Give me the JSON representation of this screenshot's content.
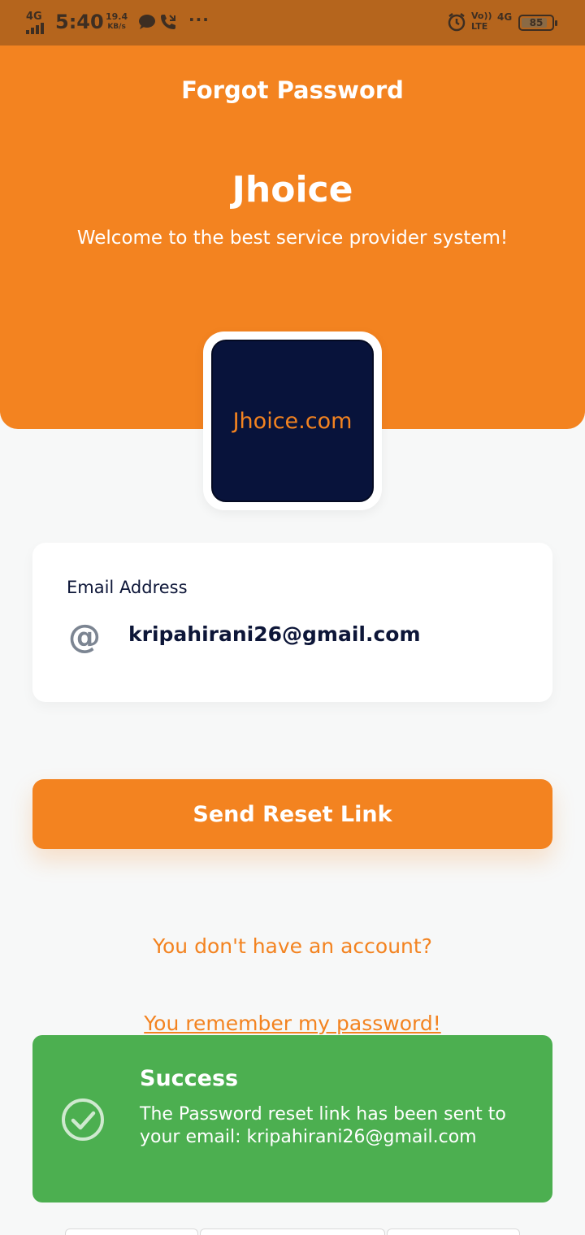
{
  "status_bar": {
    "network": "4G",
    "time": "5:40",
    "speed_value": "19.4",
    "speed_unit": "KB/s",
    "more": "···",
    "volte_top": "Vo))",
    "volte_bottom": "LTE",
    "network_right": "4G",
    "battery": "85",
    "battery_level": 0.85
  },
  "header": {
    "page_title": "Forgot Password",
    "app_name": "Jhoice",
    "tagline": "Welcome to the best service provider system!",
    "color": "#f38320"
  },
  "logo": {
    "text": "Jhoice.com"
  },
  "email": {
    "label": "Email Address",
    "icon": "@",
    "value": "kripahirani26@gmail.com"
  },
  "send_button": {
    "label": "Send Reset Link"
  },
  "links": {
    "register": "You don't have an account?",
    "login": "You remember my password!"
  },
  "toast": {
    "title": "Success",
    "message": "The Password reset link has been sent to your email: kripahirani26@gmail.com",
    "color": "#4caf50"
  }
}
